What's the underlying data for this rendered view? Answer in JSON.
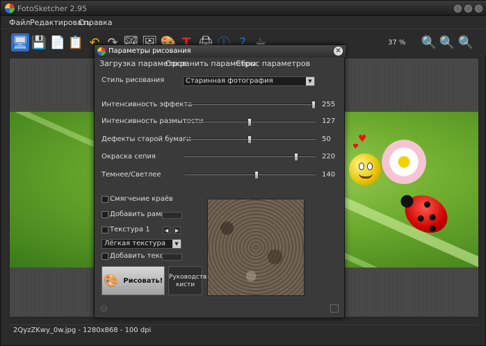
{
  "window": {
    "title": "FotoSketcher 2.95"
  },
  "menu": {
    "items": [
      "Файл",
      "Редактировать",
      "Справка"
    ]
  },
  "toolbar": {
    "zoom": "37 %",
    "icons": [
      "open-image-icon",
      "save-icon",
      "copy-icon",
      "paste-icon",
      "undo-icon",
      "redo-icon",
      "before-after-icon",
      "image-icon",
      "palette-icon",
      "text-icon",
      "print-icon",
      "info-icon",
      "help-icon",
      "coffee-icon",
      "zoom-in-icon",
      "zoom-out-icon",
      "zoom-fit-icon"
    ]
  },
  "dialog": {
    "title": "Параметры рисования",
    "menu": [
      "Загрузка параметров",
      "Сохранить параметры",
      "Сброс параметров"
    ],
    "style_label": "Стиль рисования",
    "style_value": "Старинная фотография",
    "sliders": [
      {
        "label": "Интенсивность эффекта",
        "value": "255",
        "position": 1.0
      },
      {
        "label": "Интенсивность размытости",
        "value": "127",
        "position": 0.5
      },
      {
        "label": "Дефекты старой бумаги",
        "value": "50",
        "position": 0.5
      },
      {
        "label": "Окраска сепия",
        "value": "220",
        "position": 0.86
      },
      {
        "label": "Темнее/Светлее",
        "value": "140",
        "position": 0.55
      }
    ],
    "checkboxes": {
      "smooth_edges": "Смягчение краёв",
      "add_frame": "Добавить рамку",
      "texture": "Текстура 1",
      "add_text": "Добавить текст"
    },
    "texture_select": "Лёгкая текстура",
    "draw_button": "Рисовать!",
    "brush_button_line1": "Руководство",
    "brush_button_line2": "кисти"
  },
  "status": {
    "text": "2QyzZKwy_0w.jpg - 1280x868 - 100 dpi"
  }
}
